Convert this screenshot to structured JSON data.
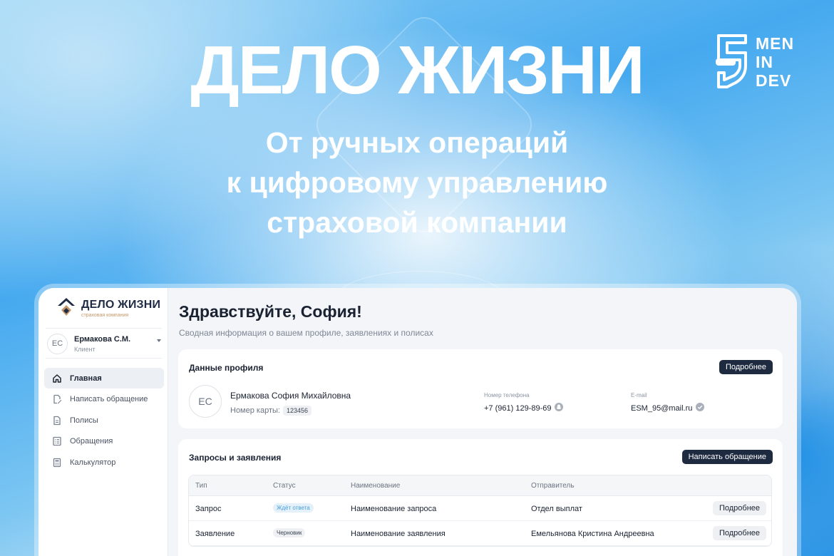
{
  "hero": {
    "title": "ДЕЛО ЖИЗНИ",
    "subtitle_lines": [
      "От ручных операций",
      "к цифровому управлению",
      "страховой компании"
    ]
  },
  "studio_logo": {
    "lines": [
      "MEN",
      "IN",
      "DEV"
    ]
  },
  "app": {
    "brand": {
      "name": "ДЕЛО ЖИЗНИ",
      "tagline": "страховая компания"
    },
    "user": {
      "initials": "ЕС",
      "name": "Ермакова С.М.",
      "role": "Клиент"
    },
    "nav": [
      {
        "label": "Главная",
        "icon": "home-icon",
        "active": true
      },
      {
        "label": "Написать обращение",
        "icon": "edit-document-icon",
        "active": false
      },
      {
        "label": "Полисы",
        "icon": "document-icon",
        "active": false
      },
      {
        "label": "Обращения",
        "icon": "list-icon",
        "active": false
      },
      {
        "label": "Калькулятор",
        "icon": "calculator-icon",
        "active": false
      }
    ],
    "greeting": "Здравствуйте, София!",
    "greeting_sub": "Сводная информация о вашем профиле, заявлениях и полисах",
    "profile": {
      "title": "Данные профиля",
      "details_button": "Подробнее",
      "initials": "ЕС",
      "full_name": "Ермакова София Михайловна",
      "card_label": "Номер карты:",
      "card_number": "123456",
      "phone_label": "Номер телефона",
      "phone": "+7 (961) 129-89-69",
      "email_label": "E-mail",
      "email": "ESM_95@mail.ru"
    },
    "requests": {
      "title": "Запросы и заявления",
      "write_button": "Написать обращение",
      "columns": [
        "Тип",
        "Статус",
        "Наименование",
        "Отправитель"
      ],
      "rows": [
        {
          "type": "Запрос",
          "status": "Ждёт ответа",
          "status_color": "#e4f1fb",
          "status_text_color": "#4a9fd8",
          "name": "Наименование запроса",
          "sender": "Отдел выплат",
          "action": "Подробнее"
        },
        {
          "type": "Заявление",
          "status": "Черновик",
          "status_color": "#eef0f3",
          "status_text_color": "#3b4352",
          "name": "Наименование заявления",
          "sender": "Емельянова Кристина Андреевна",
          "action": "Подробнее"
        }
      ]
    }
  },
  "colors": {
    "accent_dark": "#1e2a40",
    "brand_gold": "#c4986a",
    "bg_blue": "#45a9ef"
  }
}
